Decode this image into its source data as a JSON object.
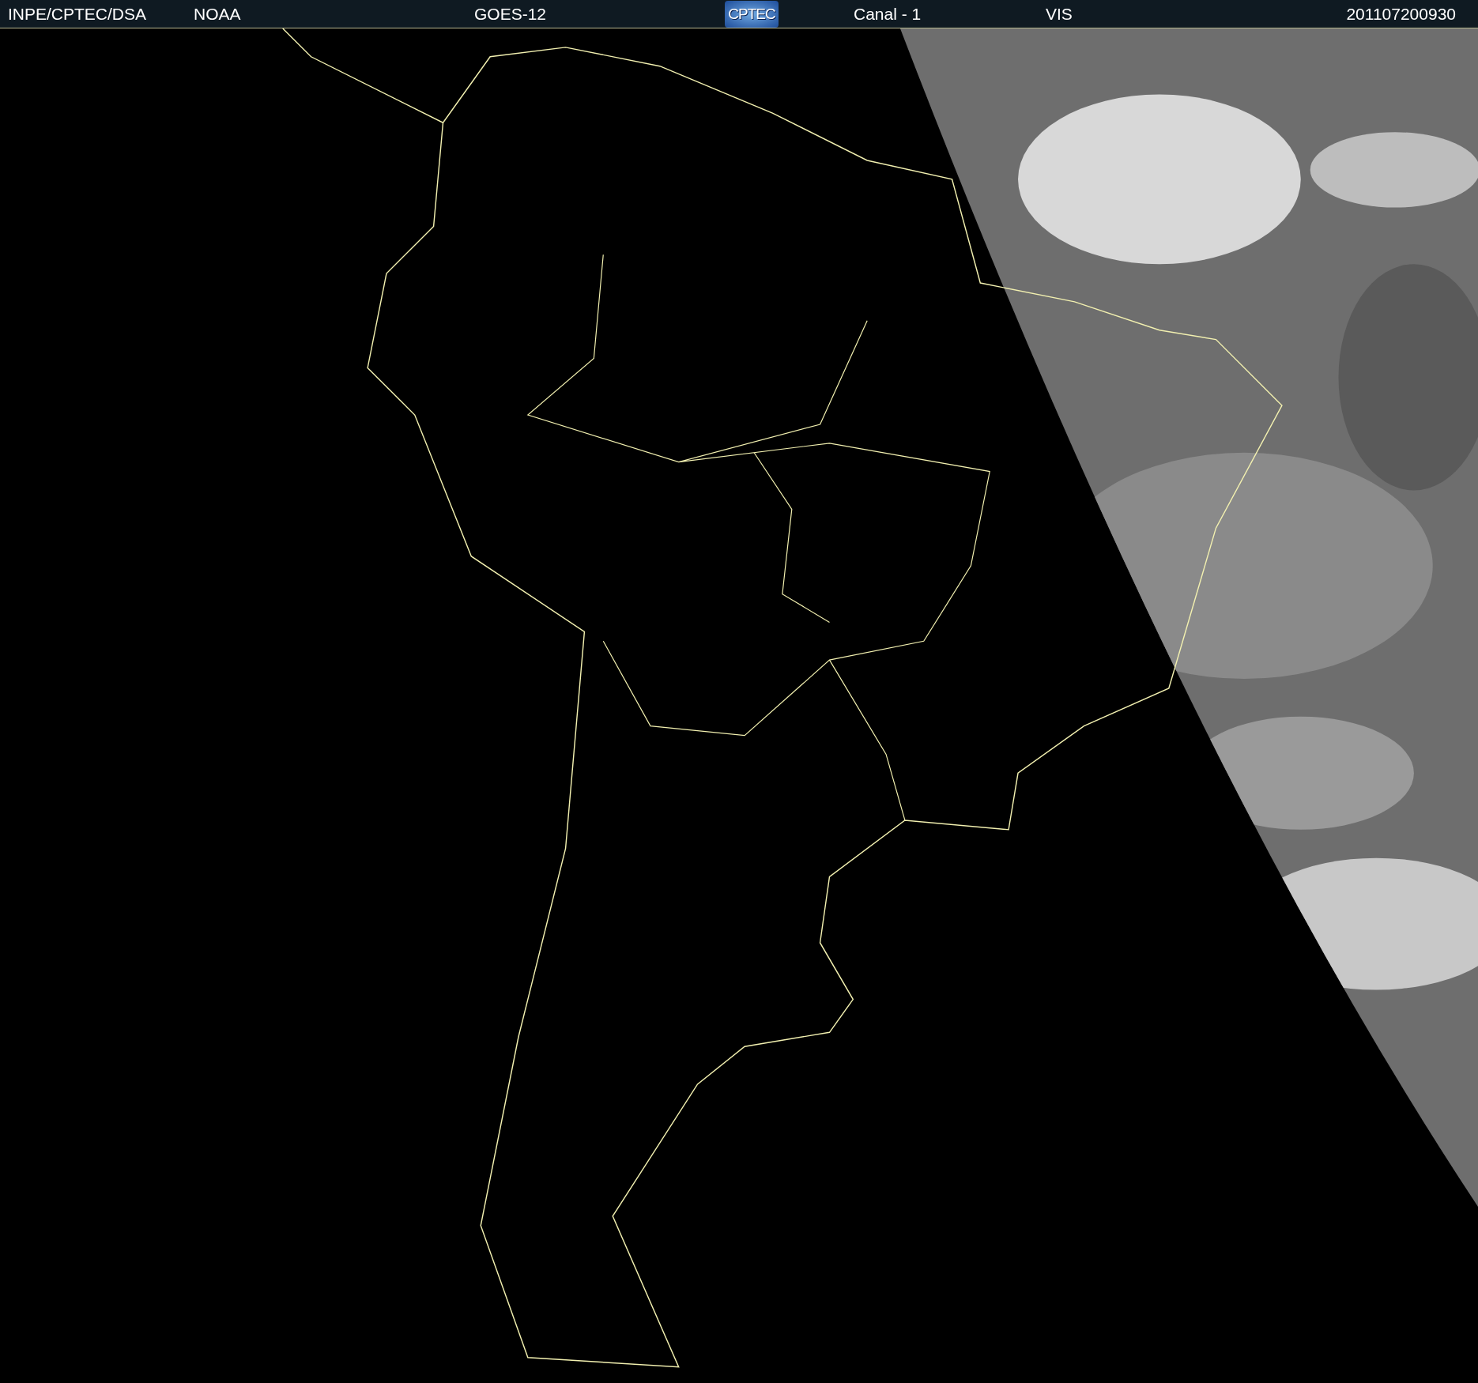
{
  "header": [
    {
      "kind": "text",
      "text": "INPE/CPTEC/DSA"
    },
    {
      "kind": "text",
      "text": "NOAA"
    },
    {
      "kind": "text",
      "text": "GOES-12"
    },
    {
      "kind": "logo",
      "text": "CPTEC"
    },
    {
      "kind": "text",
      "text": "Canal - 1"
    },
    {
      "kind": "text",
      "text": "VIS"
    },
    {
      "kind": "text",
      "text": "201107200930"
    }
  ]
}
